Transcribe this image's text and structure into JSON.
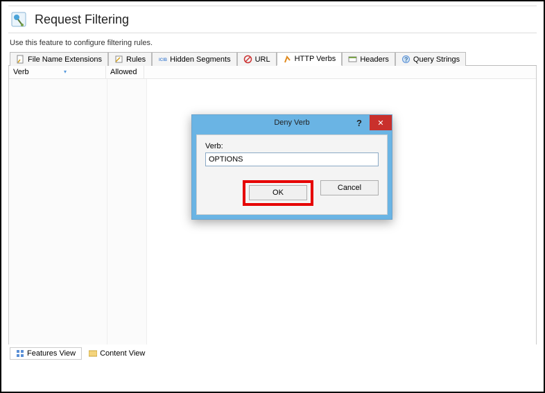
{
  "header": {
    "title": "Request Filtering"
  },
  "description": "Use this feature to configure filtering rules.",
  "tabs": {
    "items": [
      {
        "label": "File Name Extensions"
      },
      {
        "label": "Rules"
      },
      {
        "label": "Hidden Segments"
      },
      {
        "label": "URL"
      },
      {
        "label": "HTTP Verbs"
      },
      {
        "label": "Headers"
      },
      {
        "label": "Query Strings"
      }
    ],
    "active_index": 4
  },
  "columns": {
    "verb": "Verb",
    "allowed": "Allowed"
  },
  "dialog": {
    "title": "Deny Verb",
    "field_label": "Verb:",
    "field_value": "OPTIONS",
    "ok_label": "OK",
    "cancel_label": "Cancel",
    "help_label": "?",
    "close_label": "✕"
  },
  "bottom_tabs": {
    "features_label": "Features View",
    "content_label": "Content View"
  }
}
